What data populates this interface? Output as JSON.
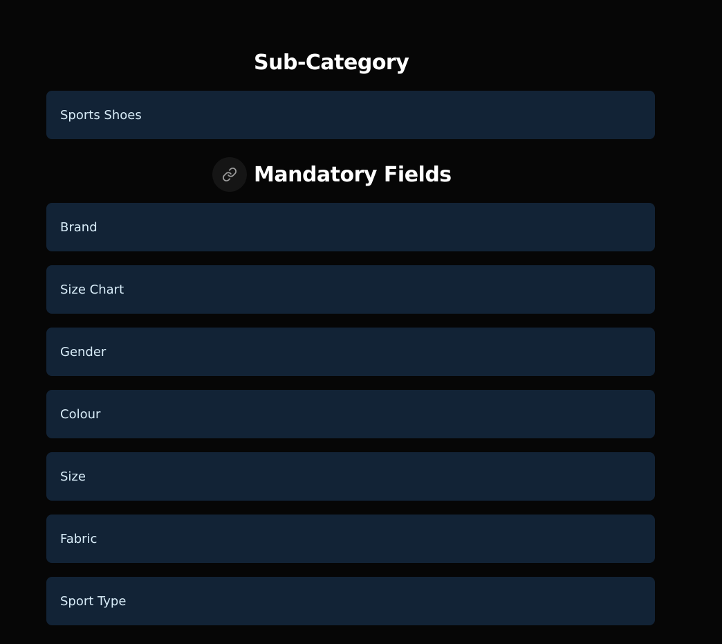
{
  "subcategory": {
    "heading": "Sub-Category",
    "value": "Sports Shoes"
  },
  "mandatory": {
    "heading": "Mandatory Fields",
    "link_icon": "link-icon",
    "fields": [
      {
        "label": "Brand"
      },
      {
        "label": "Size Chart"
      },
      {
        "label": "Gender"
      },
      {
        "label": "Colour"
      },
      {
        "label": "Size"
      },
      {
        "label": "Fabric"
      },
      {
        "label": "Sport Type"
      }
    ]
  },
  "colors": {
    "background": "#060606",
    "card": "#122336",
    "card_text": "#d8ecf8",
    "heading": "#ffffff"
  }
}
